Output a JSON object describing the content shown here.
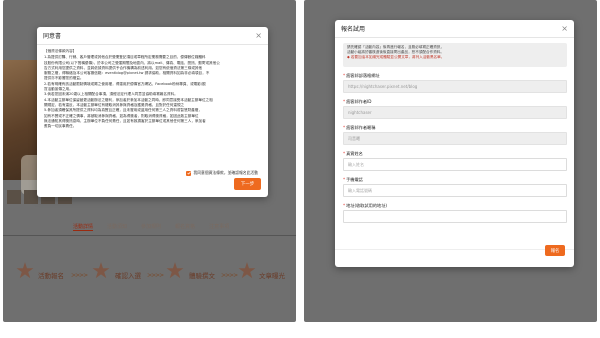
{
  "consent_modal": {
    "title": "同意書",
    "lines": [
      "【個資法條款內容】",
      "1.為提供訂購、行銷、客戶管理或其他合於營業登記項目或章程所定業務需要之目的，優傳數位媒體科",
      "技股份有限公司(以下簡稱優傳)，於本公司之營運期間及地區內，將以mail、傳真、電話、簡訊、郵寄或其他公",
      "告方式利用您提供之資料，並將依據資料提供予合作機構為前述利用。如您有依個資法第三條或其他",
      "服務之權，得聯絡及本公司客服信箱：eventblog@pixnet.tw 請求協助，相關資料如為非必填項目，不",
      "提供亦不影響您的權益。",
      "2.若有明確有該活動限制情境或屬之使用權，得運用於優傳官方網站、Facebook粉絲專頁、或電影/觀",
      "賞活動宣傳之用。",
      "3.倘若您因未滿20歲以上相關配合事項，須經法定代理人同意並協助填寫報名資料。",
      "4.本活動主辦單位保留變更活動辦法之權利，參加者於參加本活動之同時，即同意接受本活動主辦單位之相",
      "關規定，若有違反，本活動主辦單位有權取消其參與資格及獲獎資格，且對於任何違規之",
      "5.參加者須確保其所提供之資料均為真實且正確，且未冒用或盜用任何第三人之資料或智慧財產權，",
      "如有不實或不正確之情事，將被取消參與資格，如為得獎者，則取消得獎資格，如因此致主辦單位",
      "無法通知其得獎訊息時，主辦單位不負任何責任，且如有致損害於主辦單位或其他任何第三人，參加者",
      "應負一切民事責任。"
    ],
    "agree_label": "我同意個資法條款，並確認報名此活動",
    "agree_checked": true,
    "next_label": "下一步"
  },
  "background_page": {
    "nav_tabs": [
      "活動詳情",
      "活動須知",
      "參加規則",
      "報名資格",
      "注意事項"
    ],
    "steps": [
      {
        "badge": "STEP 1",
        "label": "活動報名"
      },
      {
        "badge": "STEP 2",
        "label": "確認入選"
      },
      {
        "badge": "STEP 3",
        "label": "體驗撰文"
      },
      {
        "badge": "STEP 4",
        "label": "文章曝光"
      }
    ],
    "arrow_text": ">>>>"
  },
  "register_modal": {
    "title": "報名試用",
    "notice_lines": [
      "請先確認「活動內容」後再進行報名，且務必填寫正確資訊，",
      "活動小組將於審核過後後直接寄出產品，恕不須配合作資料。",
      "◆ 若要加油本如總完成體驗並公開文章，將列入活動黑名單。"
    ],
    "fields": [
      {
        "label": "痞客邦部落格網址",
        "required": true,
        "value": "https://nightchaser.pixnet.net/blog",
        "editable": false
      },
      {
        "label": "痞客邦作者ID",
        "required": true,
        "value": "nightchaser",
        "editable": false
      },
      {
        "label": "痞客邦作者暱稱",
        "required": true,
        "value": "司音曦",
        "editable": false
      },
      {
        "label": "真實姓名",
        "required": true,
        "value": "輸入姓名",
        "editable": true
      },
      {
        "label": "手機電話",
        "required": true,
        "value": "輸入電話號碼",
        "editable": true
      },
      {
        "label": "地址(收取試用的地址)",
        "required": true,
        "value": "",
        "editable": true
      }
    ],
    "submit_label": "報名"
  },
  "colors": {
    "accent": "#ee6a1f",
    "required": "#e0322b"
  }
}
